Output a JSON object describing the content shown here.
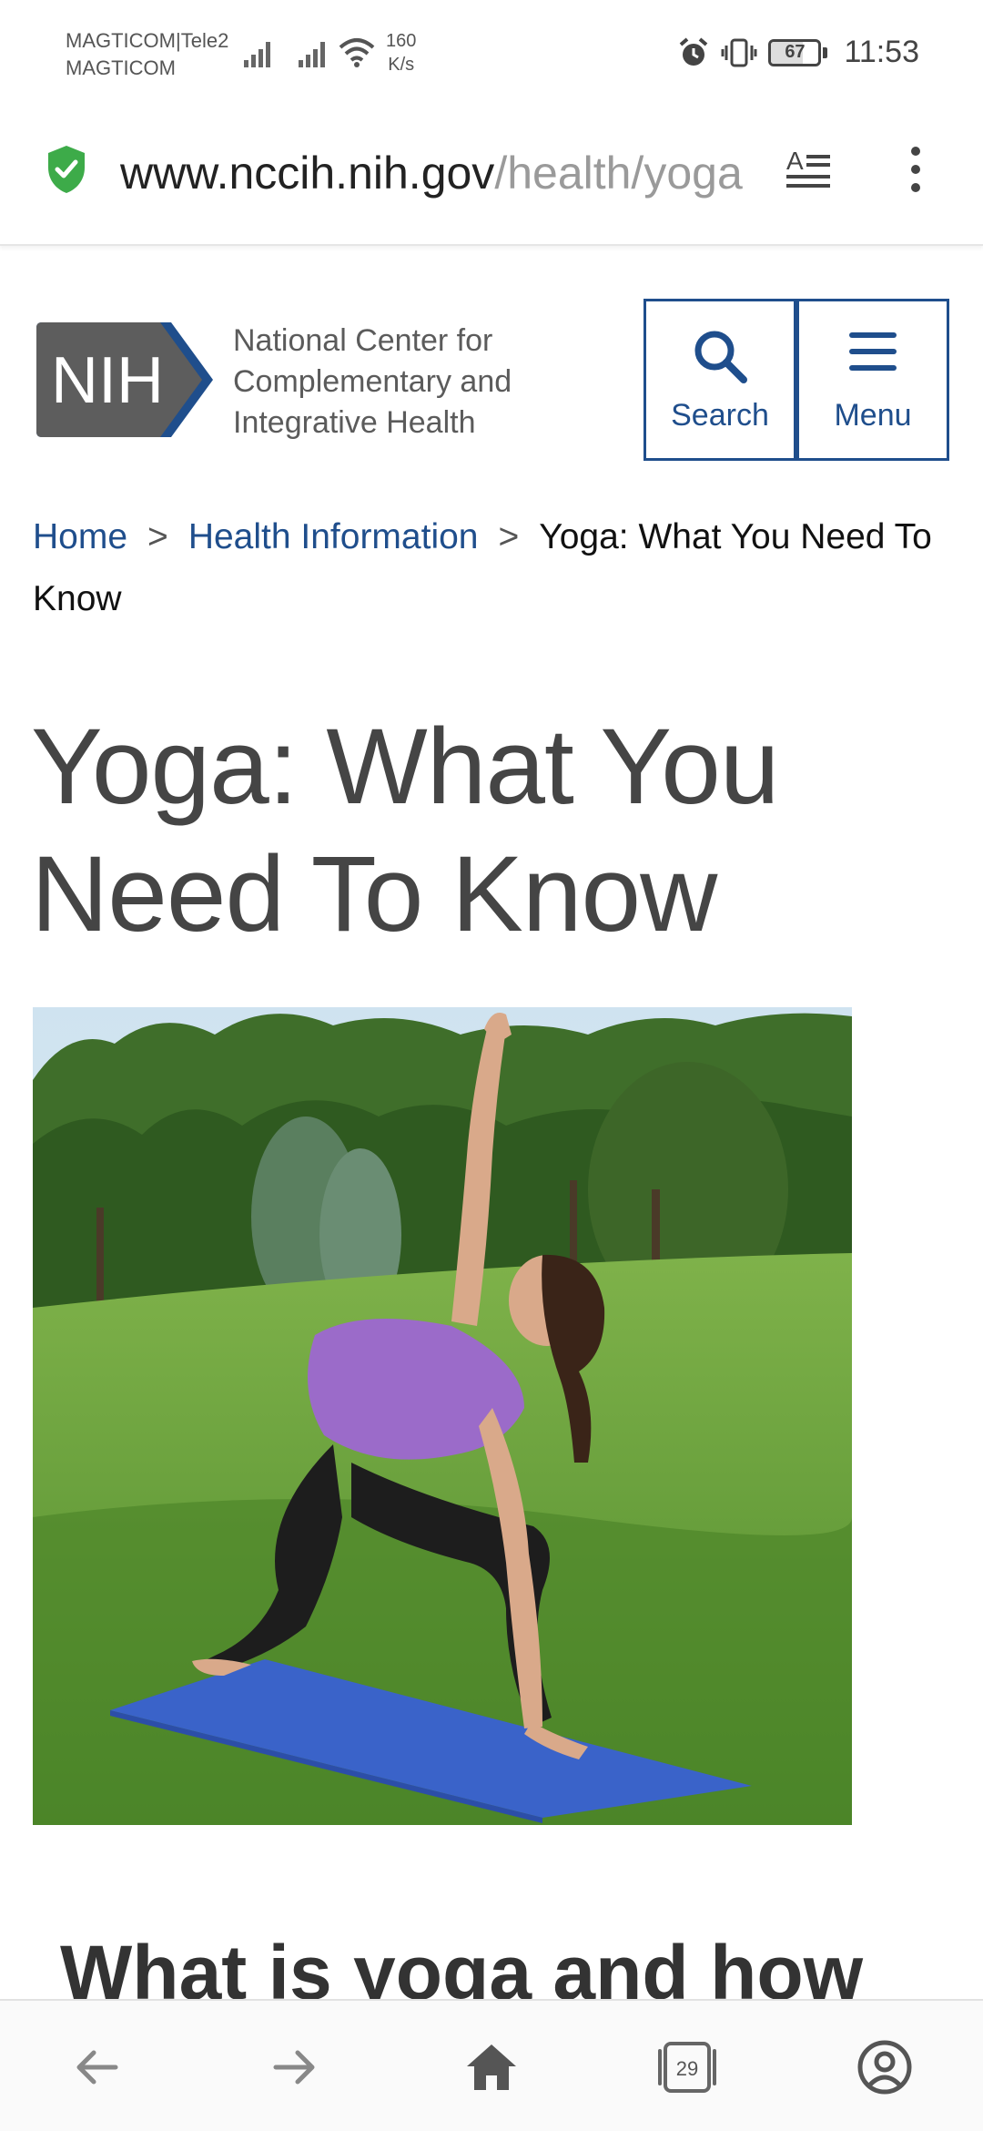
{
  "status_bar": {
    "carrier_line1": "MAGTICOM|Tele2",
    "carrier_line2": "MAGTICOM",
    "net_speed_value": "160",
    "net_speed_unit": "K/s",
    "battery_level": "67",
    "time": "11:53",
    "icons": [
      "signal-icon",
      "wifi-icon",
      "alarm-icon",
      "vibrate-icon",
      "battery-icon"
    ]
  },
  "address_bar": {
    "url_host": "www.nccih.nih.gov",
    "url_path": "/health/yoga",
    "secure_icon": "shield-check-icon",
    "reader_icon": "reader-mode-icon",
    "menu_icon": "overflow-menu-icon"
  },
  "site_header": {
    "logo_text": "NIH",
    "org_name": "National Center for Complementary and Integrative Health",
    "search_label": "Search",
    "menu_label": "Menu"
  },
  "breadcrumb": {
    "items": [
      "Home",
      "Health Information"
    ],
    "separator": ">",
    "current": "Yoga: What You Need To Know"
  },
  "page": {
    "title": "Yoga: What You Need To Know",
    "section_heading": "What is yoga and how"
  },
  "bottom_nav": {
    "tab_count": "29",
    "items": [
      "back-icon",
      "forward-icon",
      "home-icon",
      "tabs-icon",
      "account-icon"
    ]
  },
  "colors": {
    "link": "#1f4e8c",
    "title": "#454545",
    "secure": "#3dab49"
  }
}
